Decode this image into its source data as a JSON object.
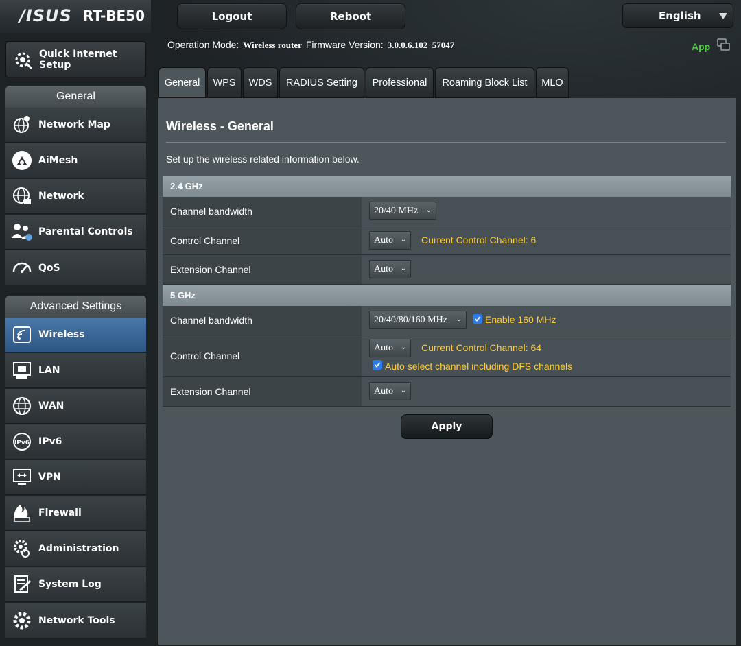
{
  "header": {
    "brand": "/ISUS",
    "model": "RT-BE50",
    "logout_label": "Logout",
    "reboot_label": "Reboot",
    "language": "English",
    "app_label": "App"
  },
  "status": {
    "opmode_label": "Operation Mode:",
    "opmode_value": "Wireless router",
    "firmware_label": "Firmware Version:",
    "firmware_value": "3.0.0.6.102_57047"
  },
  "sidebar": {
    "quick_setup": "Quick Internet Setup",
    "general_header": "General",
    "general_items": [
      {
        "label": "Network Map",
        "icon": "globe-pin-icon"
      },
      {
        "label": "AiMesh",
        "icon": "mesh-icon"
      },
      {
        "label": "Network",
        "icon": "network-globe-icon"
      },
      {
        "label": "Parental Controls",
        "icon": "parental-controls-icon"
      },
      {
        "label": "QoS",
        "icon": "gauge-icon"
      }
    ],
    "advanced_header": "Advanced Settings",
    "advanced_items": [
      {
        "label": "Wireless",
        "icon": "wireless-icon"
      },
      {
        "label": "LAN",
        "icon": "lan-icon"
      },
      {
        "label": "WAN",
        "icon": "wan-globe-icon"
      },
      {
        "label": "IPv6",
        "icon": "ipv6-icon"
      },
      {
        "label": "VPN",
        "icon": "vpn-icon"
      },
      {
        "label": "Firewall",
        "icon": "firewall-icon"
      },
      {
        "label": "Administration",
        "icon": "administration-gear-icon"
      },
      {
        "label": "System Log",
        "icon": "system-log-icon"
      },
      {
        "label": "Network Tools",
        "icon": "network-tools-icon"
      }
    ],
    "active_item": "Wireless"
  },
  "tabs": [
    "General",
    "WPS",
    "WDS",
    "RADIUS Setting",
    "Professional",
    "Roaming Block List",
    "MLO"
  ],
  "panel": {
    "title": "Wireless - General",
    "description": "Set up the wireless related information below.",
    "band_24": {
      "header": "2.4 GHz",
      "bandwidth_label": "Channel bandwidth",
      "bandwidth_value": "20/40 MHz",
      "control_label": "Control Channel",
      "control_value": "Auto",
      "control_status": "Current Control Channel: 6",
      "extension_label": "Extension Channel",
      "extension_value": "Auto"
    },
    "band_5": {
      "header": "5 GHz",
      "bandwidth_label": "Channel bandwidth",
      "bandwidth_value": "20/40/80/160 MHz",
      "enable160_label": "Enable 160 MHz",
      "control_label": "Control Channel",
      "control_value": "Auto",
      "control_status": "Current Control Channel: 64",
      "dfs_label": "Auto select channel including DFS channels",
      "extension_label": "Extension Channel",
      "extension_value": "Auto"
    },
    "apply_label": "Apply"
  },
  "colors": {
    "accent_green": "#4fcb3f",
    "status_yellow": "#ffcc33",
    "active_blue": "#2c5684"
  }
}
